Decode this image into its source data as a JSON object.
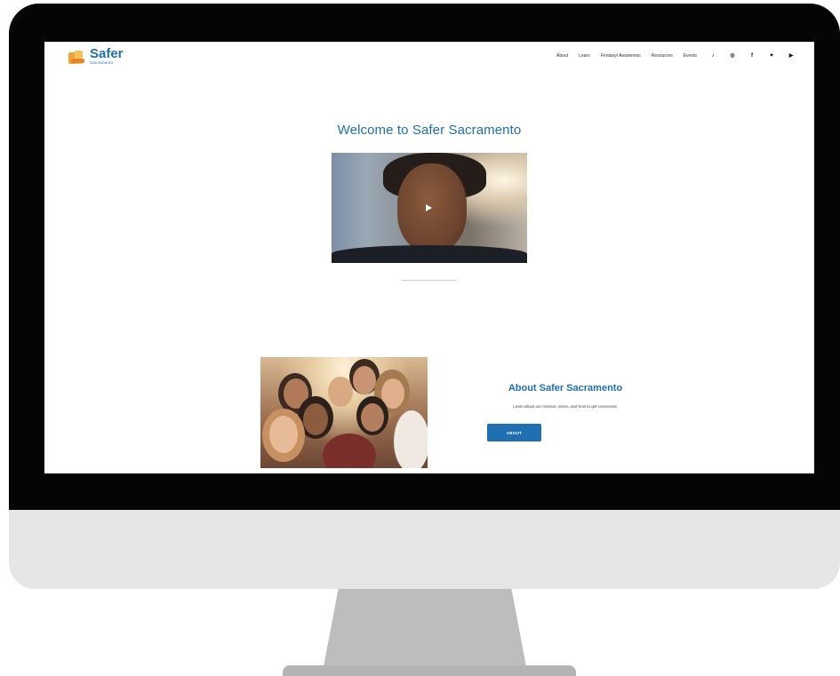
{
  "brand": {
    "name": "Safer",
    "sub": "Sacramento"
  },
  "nav": {
    "items": [
      "About",
      "Learn",
      "Fentanyl Awareness",
      "Resources",
      "Events"
    ]
  },
  "social": [
    {
      "icon": "tiktok-icon",
      "glyph": "♪"
    },
    {
      "icon": "instagram-icon",
      "glyph": "◎"
    },
    {
      "icon": "facebook-icon",
      "glyph": "f"
    },
    {
      "icon": "twitter-icon",
      "glyph": "✦"
    },
    {
      "icon": "youtube-icon",
      "glyph": "▶"
    }
  ],
  "hero": {
    "title": "Welcome to Safer Sacramento"
  },
  "about": {
    "title": "About Safer Sacramento",
    "description": "Learn about our mission, vision, and how to get connected.",
    "button_label": "ABOUT"
  },
  "colors": {
    "accent": "#1f6fb2",
    "logo_orange": "#f2a03a"
  }
}
